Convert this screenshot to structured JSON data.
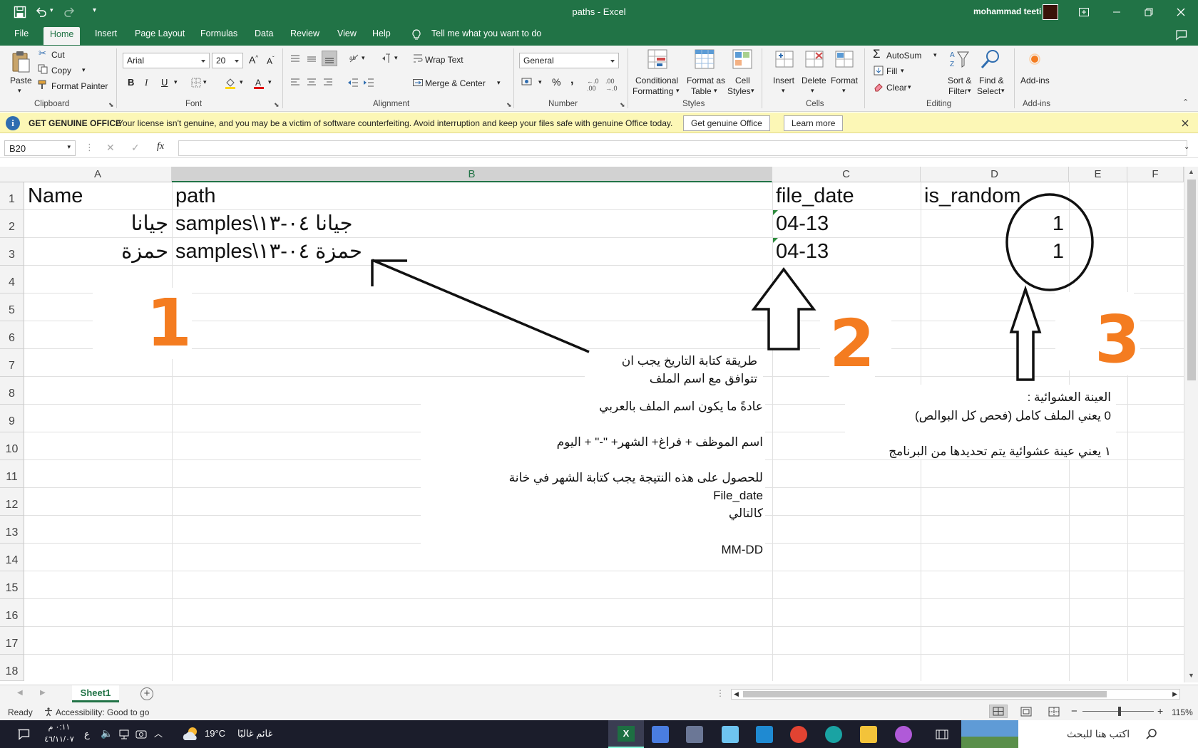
{
  "window": {
    "title": "paths  -  Excel",
    "user": "mohammad teeti"
  },
  "tabs": [
    "File",
    "Home",
    "Insert",
    "Page Layout",
    "Formulas",
    "Data",
    "Review",
    "View",
    "Help"
  ],
  "tell_me": "Tell me what you want to do",
  "ribbon": {
    "clipboard": {
      "paste": "Paste",
      "cut": "Cut",
      "copy": "Copy",
      "format_painter": "Format Painter",
      "label": "Clipboard"
    },
    "font": {
      "name": "Arial",
      "size": "20",
      "bold": "B",
      "italic": "I",
      "underline": "U",
      "label": "Font"
    },
    "alignment": {
      "wrap_text": "Wrap Text",
      "merge_center": "Merge & Center",
      "label": "Alignment"
    },
    "number": {
      "format": "General",
      "percent": "%",
      "comma": ",",
      "label": "Number"
    },
    "styles": {
      "conditional_1": "Conditional",
      "conditional_2": "Formatting",
      "format_table_1": "Format as",
      "format_table_2": "Table",
      "cell_styles_1": "Cell",
      "cell_styles_2": "Styles",
      "label": "Styles"
    },
    "cells": {
      "insert": "Insert",
      "delete": "Delete",
      "format": "Format",
      "label": "Cells"
    },
    "editing": {
      "autosum": "AutoSum",
      "fill": "Fill",
      "clear": "Clear",
      "sort_1": "Sort &",
      "sort_2": "Filter",
      "find_1": "Find &",
      "find_2": "Select",
      "label": "Editing"
    },
    "addins": {
      "addins": "Add-ins",
      "label": "Add-ins"
    }
  },
  "message_bar": {
    "title": "GET GENUINE OFFICE",
    "text": "Your license isn't genuine, and you may be a victim of software counterfeiting. Avoid interruption and keep your files safe with genuine Office today.",
    "button_primary": "Get genuine Office",
    "button_secondary": "Learn more"
  },
  "formula_bar": {
    "name_box": "B20",
    "fx": "fx",
    "cancel": "✕",
    "enter": "✓",
    "content": ""
  },
  "columns": [
    "A",
    "B",
    "C",
    "D",
    "E",
    "F"
  ],
  "rows": [
    "1",
    "2",
    "3",
    "4",
    "5",
    "6",
    "7",
    "8",
    "9",
    "10",
    "11",
    "12",
    "13",
    "14",
    "15",
    "16",
    "17",
    "18"
  ],
  "cells": {
    "A1": "Name",
    "B1": "path",
    "C1": "file_date",
    "D1": "is_random",
    "A2": "جيانا",
    "B2": "samples\\جيانا ٠٤-١٣",
    "C2": "04-13",
    "D2": "1",
    "A3": "حمزة",
    "B3": "samples\\حمزة ٠٤-١٣",
    "C3": "04-13",
    "D3": "1"
  },
  "annotations": {
    "labels": [
      "1",
      "2",
      "3"
    ],
    "note_date_1": "طريقة كتابة التاريخ يجب ان",
    "note_date_2": "تتوافق مع اسم الملف",
    "note_name_1": "عادةً ما يكون اسم الملف بالعربي",
    "note_name_2": "اسم الموظف + فراغ+ الشهر+ \"-\" + اليوم",
    "note_result_1": "للحصول على هذه النتيجة يجب كتابة الشهر في خانة",
    "note_result_2": "File_date",
    "note_result_3": "كالتالي",
    "note_result_4": "MM-DD",
    "note_random_1": "العينة العشوائية :",
    "note_random_2": "0 يعني الملف كامل (فحص كل البوالص)",
    "note_random_3": "١ يعني عينة عشوائية يتم تحديدها من البرنامج"
  },
  "sheet_tabs": [
    "Sheet1"
  ],
  "status": {
    "ready": "Ready",
    "accessibility": "Accessibility: Good to go",
    "zoom": "115%"
  },
  "taskbar": {
    "time": "٠:١١ م",
    "date": "٤٦/١١/٠٧",
    "lang": "ع",
    "weather_temp": "19°C",
    "weather_desc": "غائم غالبًا",
    "search": "اكتب هنا للبحث"
  }
}
